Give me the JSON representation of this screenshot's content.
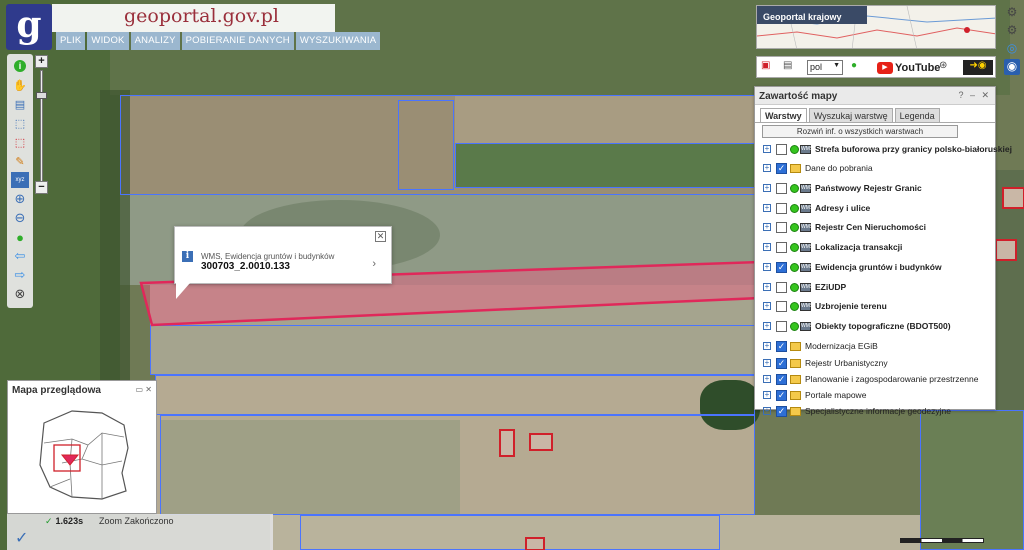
{
  "header": {
    "logo_letter": "g",
    "brand": "geoportal.gov.pl",
    "menu": [
      "PLIK",
      "WIDOK",
      "ANALIZY",
      "POBIERANIE DANYCH",
      "WYSZUKIWANIA"
    ]
  },
  "toolbar": {
    "tools": [
      {
        "icon": "info-icon",
        "glyph": "i"
      },
      {
        "icon": "pan-hand-icon",
        "glyph": "✋"
      },
      {
        "icon": "legend-icon",
        "glyph": "▤"
      },
      {
        "icon": "select-area-icon",
        "glyph": "⬚"
      },
      {
        "icon": "clear-selection-icon",
        "glyph": "⬚"
      },
      {
        "icon": "measure-pencil-icon",
        "glyph": "✎"
      },
      {
        "icon": "coordinates-icon",
        "glyph": "xyz"
      },
      {
        "icon": "zoom-in-icon",
        "glyph": "⊕"
      },
      {
        "icon": "zoom-out-icon",
        "glyph": "⊖"
      },
      {
        "icon": "full-extent-globe-icon",
        "glyph": "●"
      },
      {
        "icon": "previous-view-arrow-icon",
        "glyph": "⇦"
      },
      {
        "icon": "next-view-arrow-icon",
        "glyph": "⇨"
      },
      {
        "icon": "reset-icon",
        "glyph": "⊗"
      }
    ],
    "zoom_plus": "+",
    "zoom_minus": "−"
  },
  "popup": {
    "source": "WMS, Ewidencja gruntów i budynków",
    "parcel_id": "300703_2.0010.133",
    "close": "✕",
    "arrow": "›"
  },
  "overview": {
    "title": "Mapa przeglądowa",
    "buttons": "▭ ✕"
  },
  "status": {
    "time": "1.623s",
    "check": "✓",
    "zoom_label": "Zoom",
    "state": "Zakończono",
    "big_check": "✓"
  },
  "geoportal_krajowy": {
    "title": "Geoportal krajowy",
    "tools": [
      "gear-icon",
      "gear-icon",
      "globe-icon",
      "eye-icon"
    ]
  },
  "icon_bar": {
    "lang": "pol",
    "youtube": "YouTube"
  },
  "layers_panel": {
    "title": "Zawartość mapy",
    "window_buttons": "? – ✕",
    "tabs": [
      "Warstwy",
      "Wyszukaj warstwę",
      "Legenda"
    ],
    "expand_all": "Rozwiń inf. o wszystkich warstwach",
    "layers": [
      {
        "name": "Strefa buforowa przy granicy polsko-białoruskiej",
        "type": "wms",
        "checked": false,
        "bold": true
      },
      {
        "name": "Dane do pobrania",
        "type": "folder",
        "checked": true,
        "bold": false
      },
      {
        "name": "Państwowy Rejestr Granic",
        "type": "wms",
        "checked": false,
        "bold": true
      },
      {
        "name": "Adresy i ulice",
        "type": "wms",
        "checked": false,
        "bold": true
      },
      {
        "name": "Rejestr Cen Nieruchomości",
        "type": "wms",
        "checked": false,
        "bold": true
      },
      {
        "name": "Lokalizacja transakcji",
        "type": "wms",
        "checked": false,
        "bold": true
      },
      {
        "name": "Ewidencja gruntów i budynków",
        "type": "wms",
        "checked": true,
        "bold": true
      },
      {
        "name": "EZiUDP",
        "type": "wms",
        "checked": false,
        "bold": true
      },
      {
        "name": "Uzbrojenie terenu",
        "type": "wms",
        "checked": false,
        "bold": true
      },
      {
        "name": "Obiekty topograficzne (BDOT500)",
        "type": "wms",
        "checked": false,
        "bold": true
      },
      {
        "name": "Modernizacja EGiB",
        "type": "folder",
        "checked": true,
        "bold": false
      },
      {
        "name": "Rejestr Urbanistyczny",
        "type": "folder",
        "checked": true,
        "bold": false
      },
      {
        "name": "Planowanie i zagospodarowanie przestrzenne",
        "type": "folder",
        "checked": true,
        "bold": false
      },
      {
        "name": "Portale mapowe",
        "type": "folder",
        "checked": true,
        "bold": false
      },
      {
        "name": "Specjalistyczne informacje geodezyjne",
        "type": "folder",
        "checked": true,
        "bold": false
      }
    ]
  },
  "colors": {
    "selected_parcel": "#e0285a",
    "parcel_lines": "#4a74ff",
    "menu_bg": "#9bb7cf",
    "logo_bg": "#2f3a8c"
  }
}
